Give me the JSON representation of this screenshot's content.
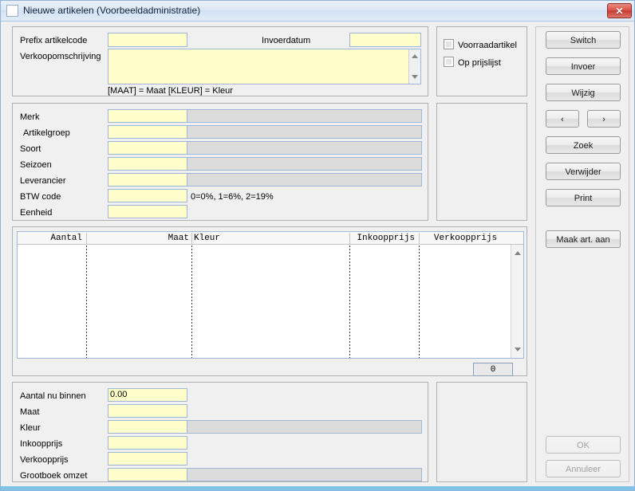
{
  "window": {
    "title": "Nieuwe artikelen (Voorbeeldadministratie)",
    "icon": "window-icon",
    "close_glyph": "✕"
  },
  "top_panel": {
    "prefix_label": "Prefix artikelcode",
    "prefix_value": "",
    "invoerdatum_label": "Invoerdatum",
    "invoerdatum_value": "",
    "description_label": "Verkoopomschrijving",
    "description_value": "",
    "hint": "[MAAT] = Maat    [KLEUR] = Kleur"
  },
  "options_panel": {
    "checkboxes": [
      {
        "label": "Voorraadartikel",
        "checked": false
      },
      {
        "label": "Op prijslijst",
        "checked": false
      }
    ]
  },
  "detail_panel": {
    "rows": [
      {
        "label": "Merk",
        "value": "",
        "has_extension": true
      },
      {
        "label": "Artikelgroep",
        "value": "",
        "has_extension": true
      },
      {
        "label": "Soort",
        "value": "",
        "has_extension": true
      },
      {
        "label": "Seizoen",
        "value": "",
        "has_extension": true
      },
      {
        "label": "Leverancier",
        "value": "",
        "has_extension": true
      },
      {
        "label": "BTW code",
        "value": "",
        "has_extension": false
      },
      {
        "label": "Eenheid",
        "value": "",
        "has_extension": false
      }
    ],
    "btw_hint": "0=0%, 1=6%, 2=19%"
  },
  "grid": {
    "columns": [
      {
        "header": "Aantal",
        "align": "right"
      },
      {
        "header": "Maat",
        "align": "right"
      },
      {
        "header": "Kleur",
        "align": "left"
      },
      {
        "header": "Inkoopprijs",
        "align": "right"
      },
      {
        "header": "Verkoopprijs",
        "align": "right"
      }
    ],
    "rows": [],
    "counter_value": "0",
    "scroll_up_icon": "triangle-up-icon",
    "scroll_down_icon": "triangle-down-icon"
  },
  "bottom_panel": {
    "rows": [
      {
        "label": "Aantal nu binnen",
        "value": "0.00",
        "has_extension": false
      },
      {
        "label": "Maat",
        "value": "",
        "has_extension": false
      },
      {
        "label": "Kleur",
        "value": "",
        "has_extension": true
      },
      {
        "label": "Inkoopprijs",
        "value": "",
        "has_extension": false
      },
      {
        "label": "Verkoopprijs",
        "value": "",
        "has_extension": false
      },
      {
        "label": "Grootboek omzet",
        "value": "",
        "has_extension": true
      }
    ]
  },
  "sidebar": {
    "buttons": [
      {
        "name": "switch",
        "label": "Switch",
        "enabled": true
      },
      {
        "name": "invoer",
        "label": "Invoer",
        "enabled": true
      },
      {
        "name": "wijzig",
        "label": "Wijzig",
        "enabled": true
      },
      {
        "name": "prev",
        "label": "‹",
        "enabled": true
      },
      {
        "name": "next",
        "label": "›",
        "enabled": true
      },
      {
        "name": "zoek",
        "label": "Zoek",
        "enabled": true
      },
      {
        "name": "verwijder",
        "label": "Verwijder",
        "enabled": true
      },
      {
        "name": "print",
        "label": "Print",
        "enabled": true
      },
      {
        "name": "maak-art-aan",
        "label": "Maak art. aan",
        "enabled": true
      }
    ],
    "footer_buttons": [
      {
        "name": "ok",
        "label": "OK",
        "enabled": false
      },
      {
        "name": "annuleer",
        "label": "Annuleer",
        "enabled": false
      }
    ]
  }
}
